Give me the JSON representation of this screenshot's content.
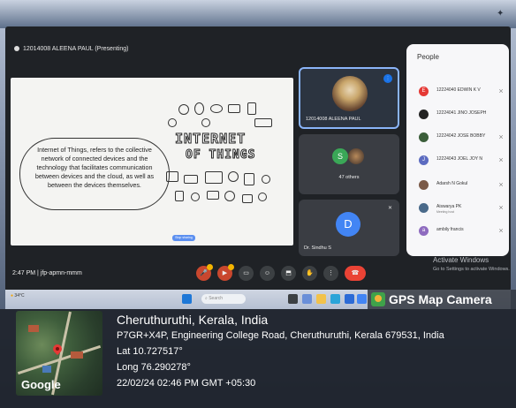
{
  "meeting": {
    "presenter_title": "12014008 ALEENA PAUL (Presenting)",
    "slide": {
      "body": "Internet of Things, refers to the collective network of connected devices and the technology that facilitates communication between devices and the cloud, as well as between the devices themselves.",
      "title_line1": "INTERNET",
      "title_line2": "OF THINGS",
      "stop_sharing": "Stop sharing"
    },
    "tiles": {
      "presenter_name": "12014008 ALEENA PAUL",
      "others_initial": "S",
      "others_label": "47 others",
      "host_initial": "D",
      "host_name": "Dr. Sindhu S"
    },
    "people_panel": {
      "title": "People",
      "entries": [
        {
          "initial": "E",
          "color": "#e53935",
          "name": "12224040 EDWIN K V",
          "sub": ""
        },
        {
          "initial": "",
          "color": "#222222",
          "name": "12224041 JINO JOSEPH",
          "sub": ""
        },
        {
          "initial": "",
          "color": "#3b5e3a",
          "name": "12224042 JOSE BOBBY",
          "sub": ""
        },
        {
          "initial": "J",
          "color": "#5c6bc0",
          "name": "12224043 JOEL JOY N",
          "sub": ""
        },
        {
          "initial": "",
          "color": "#7a5a48",
          "name": "Adarsh N Gokul",
          "sub": ""
        },
        {
          "initial": "",
          "color": "#4a6a8a",
          "name": "Aiswarya PK",
          "sub": "Meeting host"
        },
        {
          "initial": "a",
          "color": "#8e6bbf",
          "name": "ambily francis",
          "sub": ""
        }
      ]
    },
    "bottom": {
      "time_code": "2:47 PM  |  jfp-apmn-mmm"
    }
  },
  "windows": {
    "activate_line1": "Activate Windows",
    "activate_line2": "Go to Settings to activate Windows.",
    "weather": "34°C",
    "search_placeholder": "Search"
  },
  "gps": {
    "brand": "GPS Map Camera",
    "map_label": "Google",
    "place": "Cheruthuruthi, Kerala, India",
    "address": "P7GR+X4P, Engineering College Road, Cheruthuruthi, Kerala 679531, India",
    "lat": "Lat 10.727517°",
    "long": "Long 76.290278°",
    "datetime": "22/02/24 02:46 PM GMT +05:30"
  }
}
